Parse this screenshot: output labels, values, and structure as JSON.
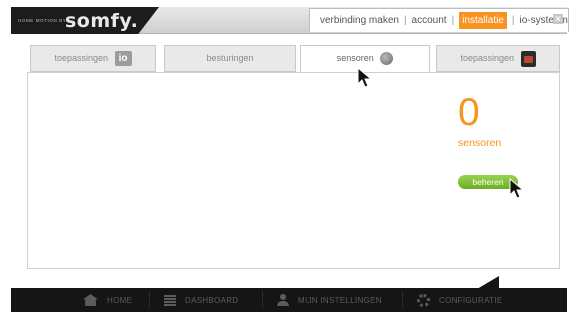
{
  "header": {
    "tagline": "HOME MOTION BY",
    "brand": "somfy.",
    "nav": {
      "connect": "verbinding maken",
      "account": "account",
      "install": "installatie",
      "io_system": "io-systeem"
    },
    "close_glyph": "✕"
  },
  "tabs": [
    {
      "label": "toepassingen",
      "icon": "io-icon",
      "icon_text": "io"
    },
    {
      "label": "besturingen",
      "icon": ""
    },
    {
      "label": "sensoren",
      "icon": "sensor-icon"
    },
    {
      "label": "toepassingen",
      "icon": "rts-icon"
    }
  ],
  "active_tab": "sensoren",
  "sensors": {
    "count": "0",
    "label": "sensoren",
    "manage_button": "beheren"
  },
  "bottom_nav": {
    "home": "HOME",
    "dashboard": "DASHBOARD",
    "settings": "MIJN INSTELLINGEN",
    "config": "CONFIGURATIE"
  },
  "colors": {
    "accent": "#f7931e",
    "button_green": "#7dbf32",
    "header_dark": "#1c1c1c",
    "bottom_bar": "#151515"
  }
}
